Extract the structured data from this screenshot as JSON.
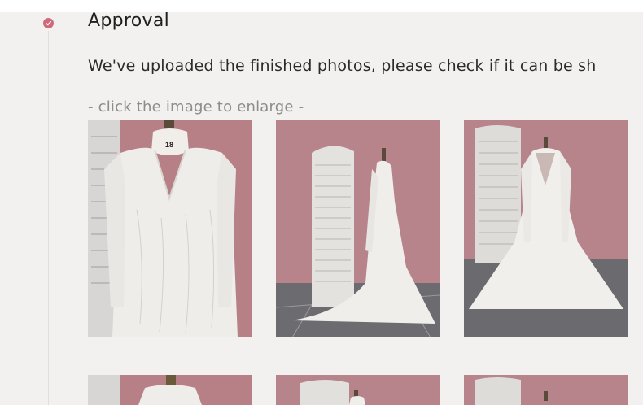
{
  "step": {
    "title": "Approval",
    "description": "We've uploaded the finished photos, please check if it can be sh",
    "hint": "- click the image to enlarge -",
    "status_icon": "check-circle-icon",
    "accent_color": "#d06a78"
  },
  "photos": [
    {
      "label": "18"
    },
    {
      "label": ""
    },
    {
      "label": ""
    },
    {
      "label": ""
    },
    {
      "label": ""
    },
    {
      "label": ""
    }
  ]
}
